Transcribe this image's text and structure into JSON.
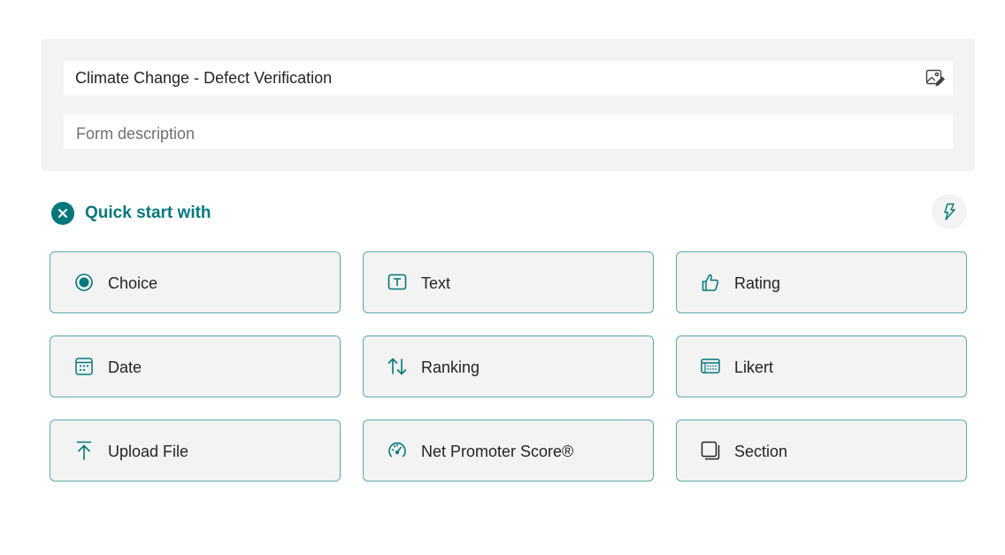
{
  "form": {
    "title": "Climate Change - Defect Verification",
    "description_placeholder": "Form description",
    "image_icon": "image-edit-icon"
  },
  "quick_start": {
    "heading": "Quick start with",
    "close_icon": "dismiss-icon",
    "bolt_icon": "lightning-icon",
    "accent_color": "#03787c",
    "items": [
      {
        "label": "Choice",
        "icon": "radio-icon"
      },
      {
        "label": "Text",
        "icon": "text-box-icon"
      },
      {
        "label": "Rating",
        "icon": "thumb-like-icon"
      },
      {
        "label": "Date",
        "icon": "calendar-icon"
      },
      {
        "label": "Ranking",
        "icon": "arrow-sort-icon"
      },
      {
        "label": "Likert",
        "icon": "grid-icon"
      },
      {
        "label": "Upload File",
        "icon": "upload-icon"
      },
      {
        "label": "Net Promoter Score®",
        "icon": "gauge-icon"
      },
      {
        "label": "Section",
        "icon": "section-icon"
      }
    ]
  }
}
